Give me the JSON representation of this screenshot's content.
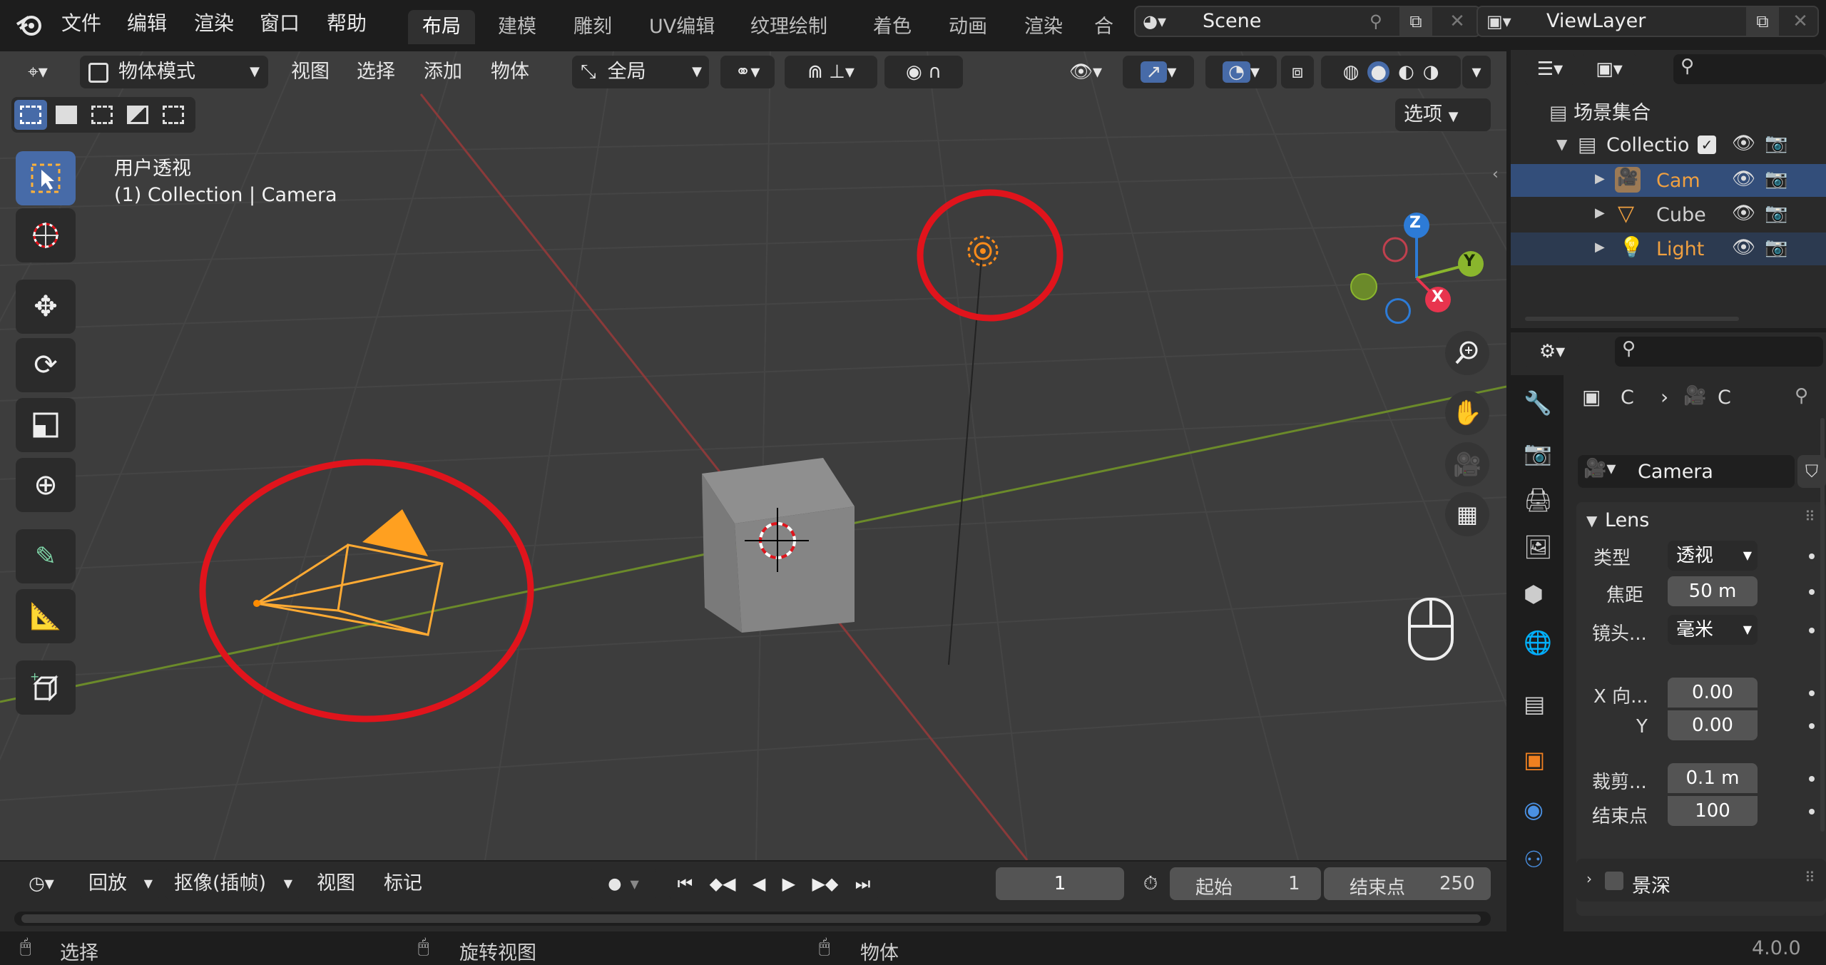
{
  "topbar": {
    "menus": [
      "文件",
      "编辑",
      "渲染",
      "窗口",
      "帮助"
    ],
    "workspaces": [
      "布局",
      "建模",
      "雕刻",
      "UV编辑",
      "纹理绘制",
      "着色",
      "动画",
      "渲染",
      "合成"
    ],
    "scene_name": "Scene",
    "viewlayer_name": "ViewLayer"
  },
  "viewport_header": {
    "mode": "物体模式",
    "menus": [
      "视图",
      "选择",
      "添加",
      "物体"
    ],
    "transform_orientation": "全局",
    "options_label": "选项"
  },
  "viewport": {
    "view_name": "用户透视",
    "object_info": "(1) Collection | Camera",
    "gizmo_axes": {
      "x": "X",
      "y": "Y",
      "z": "Z"
    },
    "colors": {
      "x_axis": "#e8344e",
      "y_axis": "#8ab62d",
      "z_axis": "#2d7bd6",
      "selection": "#ffaa33",
      "annotation": "#e0141c"
    }
  },
  "outliner": {
    "root": "场景集合",
    "collection": "Collectio",
    "items": [
      {
        "label": "Cam",
        "color": "#f0a040",
        "selected": true
      },
      {
        "label": "Cube",
        "color": "#d0d0d0",
        "selected": false
      },
      {
        "label": "Light",
        "color": "#f0a040",
        "selected": true
      }
    ]
  },
  "properties": {
    "breadcrumb_a": "C",
    "breadcrumb_b": "C",
    "data_name": "Camera",
    "lens_section": "Lens",
    "type_label": "类型",
    "type_value": "透视",
    "focal_label": "焦距",
    "focal_value": "50 m",
    "lens_unit_label": "镜头...",
    "lens_unit_value": "毫米",
    "shift_x_label": "X 向...",
    "shift_x_value": "0.00",
    "shift_y_label": "Y",
    "shift_y_value": "0.00",
    "clip_start_label": "裁剪...",
    "clip_start_value": "0.1 m",
    "clip_end_label": "结束点",
    "clip_end_value": "100",
    "dof_section": "景深"
  },
  "timeline": {
    "playback": "回放",
    "keying": "抠像(插帧)",
    "view": "视图",
    "marker": "标记",
    "current_frame": "1",
    "start_label": "起始",
    "start_value": "1",
    "end_label": "结束点",
    "end_value": "250"
  },
  "statusbar": {
    "select": "选择",
    "rotate": "旋转视图",
    "object": "物体",
    "version": "4.0.0"
  }
}
